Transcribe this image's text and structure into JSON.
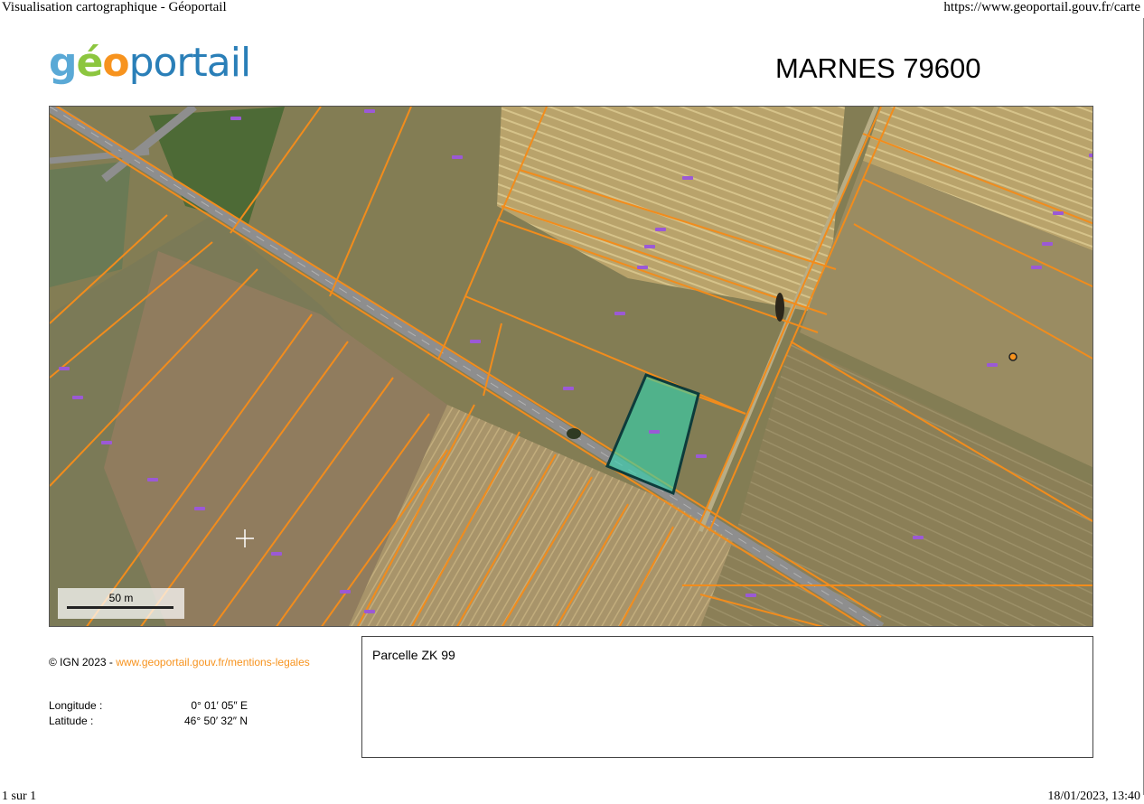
{
  "browser": {
    "title": "Visualisation cartographique - Géoportail",
    "url": "https://www.geoportail.gouv.fr/carte",
    "page": "1 sur 1",
    "date": "18/01/2023, 13:40"
  },
  "header": {
    "logo_g": "g",
    "logo_e": "é",
    "logo_o": "o",
    "logo_rest": "portail",
    "commune": "MARNES 79600"
  },
  "map": {
    "scale_label": "50 m",
    "colors": {
      "parcel_line": "#f28c1c",
      "selected_fill": "#2fd6b0",
      "selected_stroke": "#0d3b3b",
      "road": "#8e8e8e",
      "label": "#9b59d6"
    },
    "marker_icon": "location-dot-icon",
    "cursor_icon": "crosshair-icon"
  },
  "footer": {
    "copyright": "© IGN 2023 - ",
    "legal_link": "www.geoportail.gouv.fr/mentions-legales",
    "longitude_label": "Longitude :",
    "longitude_value": "0° 01′ 05″ E",
    "latitude_label": "Latitude :",
    "latitude_value": "46° 50′ 32″ N"
  },
  "info": {
    "parcel": "Parcelle ZK 99"
  }
}
